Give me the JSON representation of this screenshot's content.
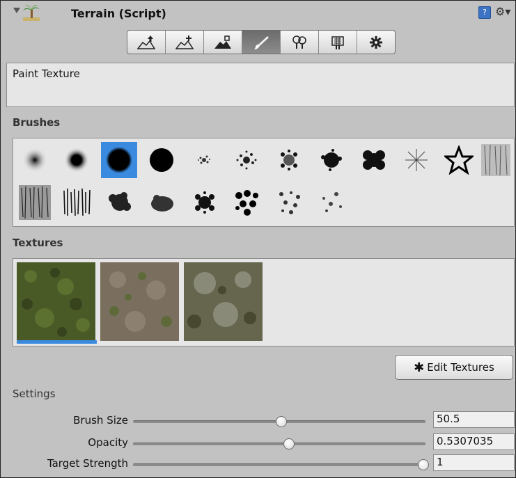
{
  "header": {
    "title": "Terrain (Script)",
    "help_glyph": "?",
    "gear_glyph": "⚙▾"
  },
  "toolbar": {
    "tools": [
      {
        "icon": "raise-terrain-icon"
      },
      {
        "icon": "paint-height-icon"
      },
      {
        "icon": "smooth-height-icon"
      },
      {
        "icon": "paint-texture-icon",
        "active": true
      },
      {
        "icon": "place-trees-icon"
      },
      {
        "icon": "paint-details-icon"
      },
      {
        "icon": "terrain-settings-icon"
      }
    ]
  },
  "description": "Paint Texture",
  "brushes": {
    "label": "Brushes",
    "selected_index": 2,
    "count": 20
  },
  "textures": {
    "label": "Textures",
    "selected_index": 0,
    "items": [
      {
        "name": "grass",
        "color": "#4a5a2a"
      },
      {
        "name": "dirt-grass",
        "color": "#7a7060"
      },
      {
        "name": "rock",
        "color": "#6a6a58"
      }
    ]
  },
  "edit_textures_button": "Edit Textures",
  "settings": {
    "label": "Settings",
    "rows": [
      {
        "label": "Brush Size",
        "value": "50.5",
        "fraction": 0.506
      },
      {
        "label": "Opacity",
        "value": "0.5307035",
        "fraction": 0.531
      },
      {
        "label": "Target Strength",
        "value": "1",
        "fraction": 1.0
      }
    ]
  },
  "colors": {
    "selection": "#3a8be0",
    "panel": "#c2c2c2",
    "box": "#e6e6e6"
  }
}
